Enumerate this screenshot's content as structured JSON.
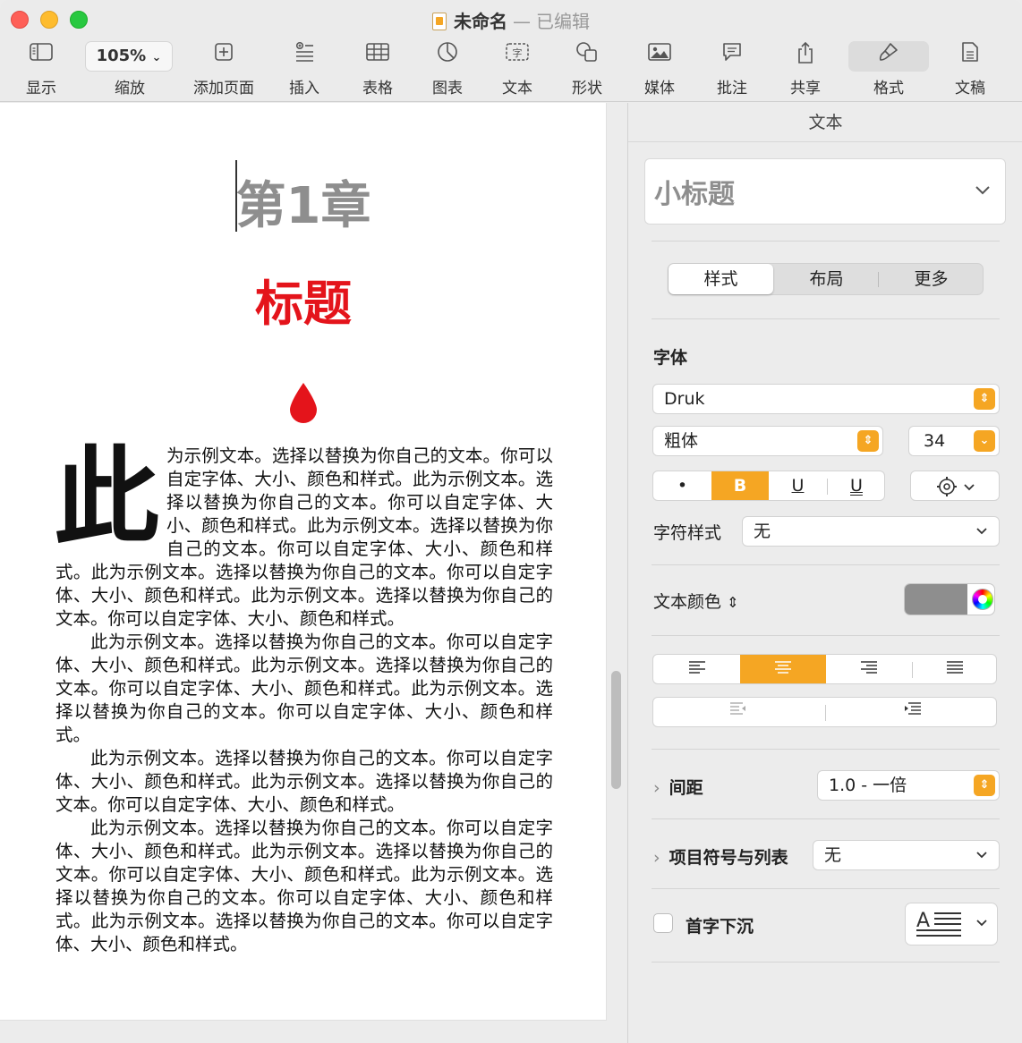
{
  "window": {
    "title": "未命名",
    "title_separator": "—",
    "title_status": "已编辑"
  },
  "toolbar": {
    "view_label": "显示",
    "zoom_value": "105%",
    "zoom_label": "缩放",
    "add_page_label": "添加页面",
    "insert_label": "插入",
    "table_label": "表格",
    "chart_label": "图表",
    "text_label": "文本",
    "shape_label": "形状",
    "media_label": "媒体",
    "comment_label": "批注",
    "share_label": "共享",
    "format_label": "格式",
    "document_label": "文稿"
  },
  "document": {
    "chapter": "第1章",
    "heading": "标题",
    "drop_cap": "此",
    "paragraph1": "为示例文本。选择以替换为你自己的文本。你可以自定字体、大小、颜色和样式。此为示例文本。选择以替换为你自己的文本。你可以自定字体、大小、颜色和样式。此为示例文本。选择以替换为你自己的文本。你可以自定字体、大小、颜色和样式。此为示例文本。选择以替换为你自己的文本。你可以自定字体、大小、颜色和样式。此为示例文本。选择以替换为你自己的文本。你可以自定字体、大小、颜色和样式。",
    "paragraph2": "此为示例文本。选择以替换为你自己的文本。你可以自定字体、大小、颜色和样式。此为示例文本。选择以替换为你自己的文本。你可以自定字体、大小、颜色和样式。此为示例文本。选择以替换为你自己的文本。你可以自定字体、大小、颜色和样式。",
    "paragraph3": "此为示例文本。选择以替换为你自己的文本。你可以自定字体、大小、颜色和样式。此为示例文本。选择以替换为你自己的文本。你可以自定字体、大小、颜色和样式。",
    "paragraph4": "此为示例文本。选择以替换为你自己的文本。你可以自定字体、大小、颜色和样式。此为示例文本。选择以替换为你自己的文本。你可以自定字体、大小、颜色和样式。此为示例文本。选择以替换为你自己的文本。你可以自定字体、大小、颜色和样式。此为示例文本。选择以替换为你自己的文本。你可以自定字体、大小、颜色和样式。",
    "heading_color": "#e4141b",
    "chapter_color": "#8e8e8e"
  },
  "sidebar": {
    "header": "文本",
    "paragraph_style": "小标题",
    "tabs": [
      "样式",
      "布局",
      "更多"
    ],
    "font_section": "字体",
    "font_name": "Druk",
    "font_weight": "粗体",
    "font_size": "34",
    "style_buttons": {
      "more": "•",
      "bold": "B",
      "underline": "U",
      "double_underline": "U"
    },
    "character_style_label": "字符样式",
    "character_style_value": "无",
    "text_color_label": "文本颜色",
    "text_color": "#8e8e8e",
    "spacing_label": "间距",
    "spacing_value": "1.0 - 一倍",
    "bullets_label": "项目符号与列表",
    "bullets_value": "无",
    "drop_cap_label": "首字下沉",
    "accent_color": "#f5a623"
  }
}
